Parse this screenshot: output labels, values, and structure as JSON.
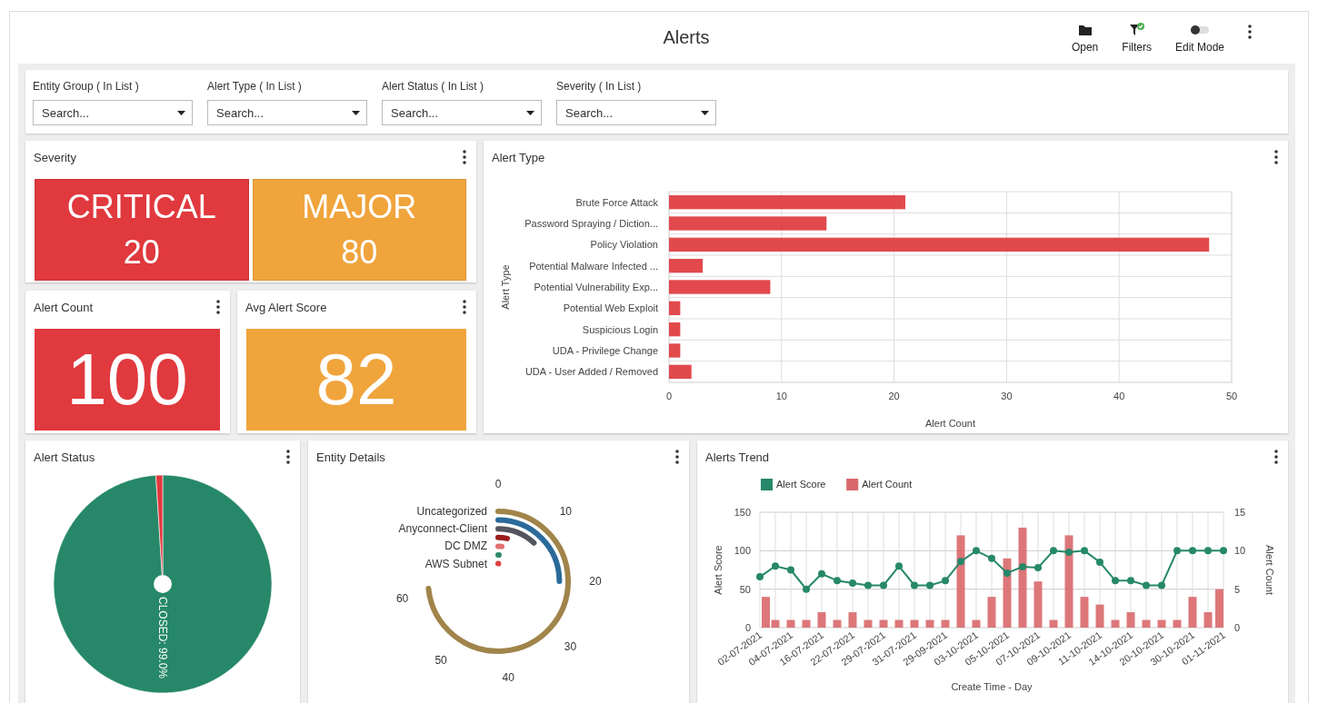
{
  "header": {
    "title": "Alerts",
    "actions": [
      {
        "kind": "open",
        "label": "Open"
      },
      {
        "kind": "filters",
        "label": "Filters"
      },
      {
        "kind": "toggle",
        "label": "Edit Mode",
        "on": false
      },
      {
        "kind": "more"
      }
    ]
  },
  "filters": [
    {
      "label": "Entity Group ( In List )",
      "placeholder": "Search..."
    },
    {
      "label": "Alert Type ( In List )",
      "placeholder": "Search..."
    },
    {
      "label": "Alert Status ( In List )",
      "placeholder": "Search..."
    },
    {
      "label": "Severity ( In List )",
      "placeholder": "Search..."
    }
  ],
  "severity": {
    "title": "Severity",
    "tiles": [
      {
        "label": "CRITICAL",
        "value": "20",
        "color": "#e0393e"
      },
      {
        "label": "MAJOR",
        "value": "80",
        "color": "#f0a43c"
      }
    ]
  },
  "alert_count": {
    "title": "Alert Count",
    "value": "100",
    "color": "#e0393e"
  },
  "avg_alert_score": {
    "title": "Avg Alert Score",
    "value": "82",
    "color": "#f0a43c"
  },
  "alert_type": {
    "title": "Alert Type",
    "chart_data": {
      "type": "bar",
      "orientation": "horizontal",
      "xlabel": "Alert Count",
      "ylabel": "Alert Type",
      "grid": true,
      "categories": [
        "Brute Force Attack",
        "Password Spraying / Diction...",
        "Policy Violation",
        "Potential Malware Infected ...",
        "Potential Vulnerability Exp...",
        "Potential Web Exploit",
        "Suspicious Login",
        "UDA - Privilege Change",
        "UDA - User Added / Removed"
      ],
      "series": [
        {
          "color": "#e0393e",
          "values": [
            21,
            14,
            48,
            3,
            9,
            1,
            1,
            1,
            2
          ]
        }
      ],
      "xlim": [
        0,
        50
      ],
      "xticks": [
        0,
        10,
        20,
        30,
        40,
        50
      ]
    }
  },
  "alert_status": {
    "title": "Alert Status",
    "chart_data": {
      "type": "pie",
      "series": [
        {
          "values": [
            99.0,
            1.0
          ],
          "colors": [
            "#268869",
            "#e0393e"
          ]
        }
      ],
      "value_labels": [
        "CLOSED: 99.0%",
        null
      ]
    }
  },
  "entity_details": {
    "title": "Entity Details",
    "legend_labels": [
      "Uncategorized",
      "Anyconnect-Client",
      "DC DMZ",
      "AWS Subnet"
    ],
    "scale_labels": [
      "0",
      "10",
      "20",
      "30",
      "40",
      "50",
      "60"
    ]
  },
  "alerts_trend": {
    "title": "Alerts Trend",
    "chart_data": {
      "type": "bar",
      "xlabel": "Create Time - Day",
      "ylabel": "Alert Score",
      "y2label": "Alert Count",
      "categories": [
        "02-07-2021",
        null,
        "04-07-2021",
        null,
        "16-07-2021",
        null,
        "22-07-2021",
        null,
        "29-07-2021",
        null,
        "31-07-2021",
        null,
        "29-09-2021",
        null,
        "03-10-2021",
        null,
        "05-10-2021",
        null,
        "07-10-2021",
        null,
        "09-10-2021",
        null,
        "11-10-2021",
        null,
        "14-10-2021",
        null,
        "20-10-2021",
        null,
        "30-10-2021",
        null,
        "01-11-2021"
      ],
      "grid": true,
      "legend": "top-left",
      "ylim": [
        0,
        150
      ],
      "yticks": [
        0,
        50,
        100,
        150
      ],
      "y2lim": [
        0,
        15
      ],
      "y2ticks": [
        0,
        5,
        10,
        15
      ],
      "series": [
        {
          "name": "Alert Score",
          "type": "line",
          "marker": "circle",
          "color": "#268869",
          "values": [
            66,
            80,
            75,
            50,
            70,
            61,
            58,
            55,
            55,
            80,
            55,
            55,
            61,
            86,
            100,
            90,
            71,
            79,
            78,
            100,
            98,
            100,
            85,
            61,
            61,
            55,
            55,
            100,
            100,
            100,
            100
          ]
        },
        {
          "name": "Alert Count",
          "type": "bar",
          "axis": "y2",
          "color": "#d9686b",
          "values": [
            4,
            1,
            1,
            1,
            2,
            1,
            2,
            1,
            1,
            1,
            1,
            1,
            1,
            12,
            1,
            4,
            9,
            13,
            6,
            1,
            12,
            4,
            3,
            1,
            2,
            1,
            1,
            1,
            4,
            2,
            5
          ]
        }
      ]
    }
  }
}
